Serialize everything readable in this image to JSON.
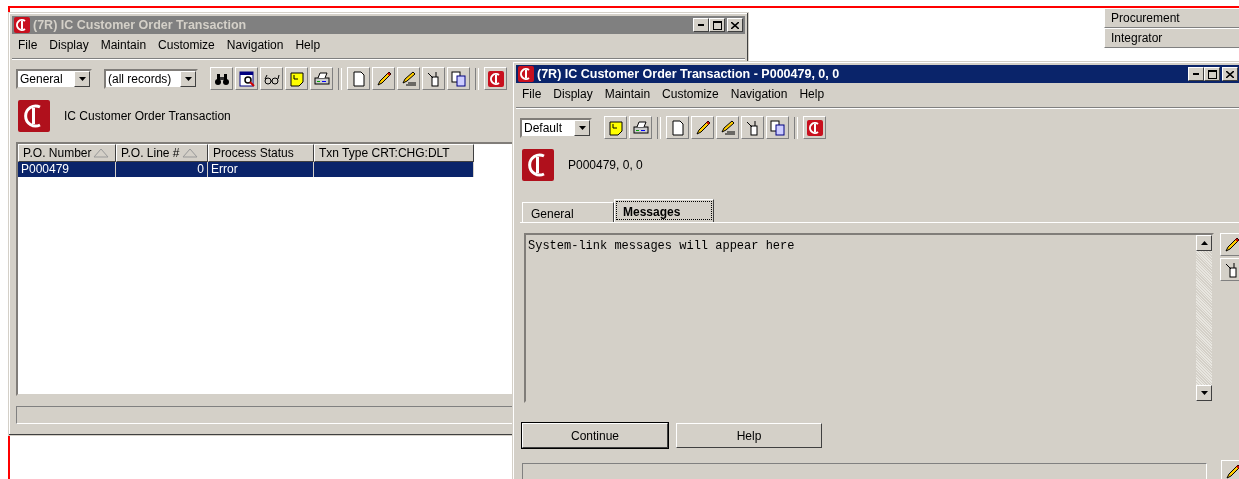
{
  "side_buttons": [
    {
      "label": "Procurement"
    },
    {
      "label": "Integrator"
    }
  ],
  "back_window": {
    "title": "(7R) IC Customer Order Transaction",
    "active": false,
    "menu": [
      "File",
      "Display",
      "Maintain",
      "Customize",
      "Navigation",
      "Help"
    ],
    "view_select": "General",
    "filter_select": "(all records)",
    "heading": "IC Customer Order Transaction",
    "table": {
      "columns": [
        {
          "label": "P.O. Number",
          "sorted": true
        },
        {
          "label": "P.O. Line #",
          "sorted": true
        },
        {
          "label": "Process Status",
          "sorted": false
        },
        {
          "label": "Txn Type CRT:CHG:DLT",
          "sorted": false
        }
      ],
      "rows": [
        {
          "cells": [
            "P000479",
            "0",
            "Error",
            ""
          ],
          "selected": true
        }
      ]
    }
  },
  "front_window": {
    "title": "(7R) IC Customer Order Transaction - P000479, 0, 0",
    "active": true,
    "menu": [
      "File",
      "Display",
      "Maintain",
      "Customize",
      "Navigation",
      "Help"
    ],
    "view_select": "Default",
    "heading": "P000479, 0, 0",
    "tabs": [
      {
        "label": "General",
        "selected": false
      },
      {
        "label": "Messages",
        "selected": true
      }
    ],
    "messages": "System-link messages will appear here",
    "buttons": [
      "Continue",
      "Help"
    ]
  }
}
